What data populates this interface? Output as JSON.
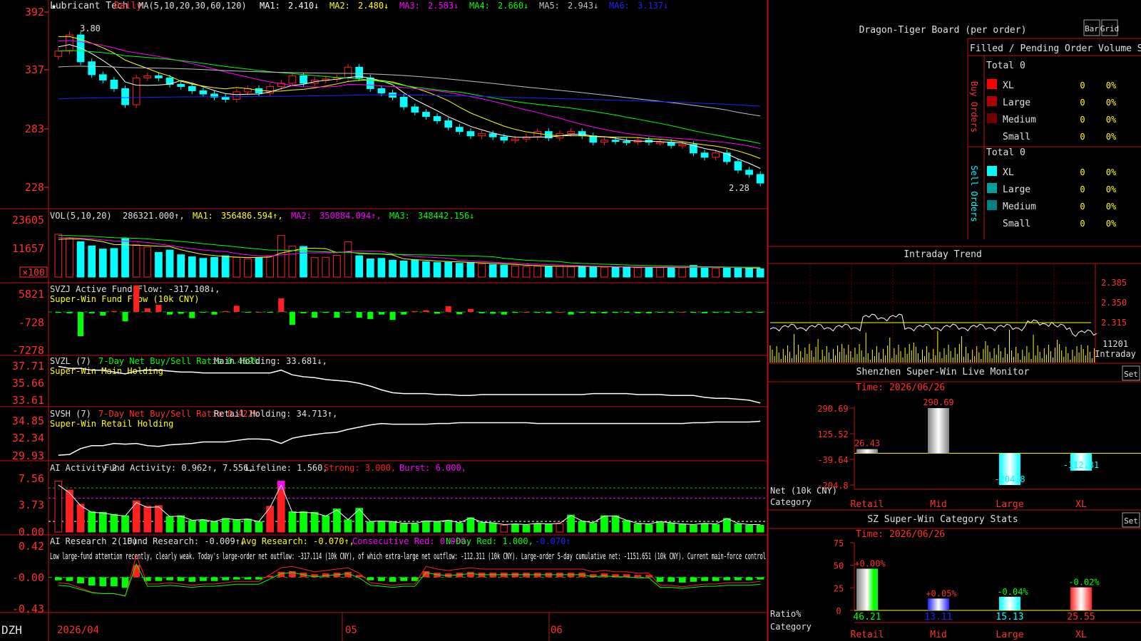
{
  "app": {
    "brand": "DZH",
    "stock_name": "Lubricant Tech",
    "period": "Daily",
    "date_ticks": [
      "2026/04",
      "05",
      "06"
    ]
  },
  "colors": {
    "up": "#ff2020",
    "down": "#00ffff",
    "grid": "#a00000",
    "ma1": "#ffffff",
    "ma2": "#ffff00",
    "ma3": "#ff00ff",
    "ma4": "#00ff00",
    "ma5": "#c0c0c0",
    "ma6": "#2020ff",
    "green_bar": "#00ff00"
  },
  "main": {
    "legend_prefix": "MA(5,10,20,30,60,120)",
    "ma": [
      {
        "label": "MA1:",
        "value": "2.410↓"
      },
      {
        "label": "MA2:",
        "value": "2.480↓"
      },
      {
        "label": "MA3:",
        "value": "2.583↓"
      },
      {
        "label": "MA4:",
        "value": "2.660↓"
      },
      {
        "label": "MA5:",
        "value": "2.943↓"
      },
      {
        "label": "MA6:",
        "value": "3.137↓"
      }
    ],
    "y_ticks": [
      "392",
      "337",
      "283",
      "228"
    ],
    "high_label": "3.80",
    "low_label": "2.28"
  },
  "vol": {
    "legend_prefix": "VOL(5,10,20)",
    "current": "286321.000↑,",
    "ma": [
      {
        "label": "MA1:",
        "value": "356486.594↑,"
      },
      {
        "label": "MA2:",
        "value": "350884.094↑,"
      },
      {
        "label": "MA3:",
        "value": "348442.156↓"
      }
    ],
    "y_ticks": [
      "23605",
      "11657"
    ],
    "unit": "×100"
  },
  "svzj": {
    "line1": "SVZJ Active Fund Flow: -317.108↓,",
    "line2": "Super-Win Fund Flow (10k CNY)",
    "y_ticks": [
      "5821",
      "-728",
      "-7278"
    ]
  },
  "svzl": {
    "name": "SVZL (7)",
    "desc": "7-Day Net Buy/Sell Ratio 0.469%",
    "holding": "Main Holding: 33.681↓,",
    "line2": "Super-Win Main Holding",
    "y_ticks": [
      "37.71",
      "35.66",
      "33.61"
    ]
  },
  "svsh": {
    "name": "SVSH (7)",
    "desc": "7-Day Net Buy/Sell Ratio 0.422%",
    "holding": "Retail Holding: 34.713↑,",
    "line2": "Super-Win Retail Holding",
    "y_ticks": [
      "34.85",
      "32.34",
      "29.93"
    ]
  },
  "ai_active": {
    "name": "AI Activity 2",
    "fund": "Fund Activity: 0.962↑, 7.556,",
    "life": "Lifeline: 1.560,",
    "strong": "Strong: 3.000,",
    "burst": "Burst: 6.000,",
    "y_ticks": [
      "7.56",
      "3.73",
      "0.00"
    ]
  },
  "ai_research": {
    "name": "AI Research 2(10)",
    "fund": "Fund Research: -0.009↑,",
    "avg": "Avg Research: -0.070↑,",
    "consec": "Consecutive Red: 0.000,",
    "nday": "N-Day Red: 1.000,",
    "last": "-0.070↑",
    "commentary": "Low large-fund attention recently, clearly weak. Today's large-order net outflow: -317.114 (10k CNY), of which extra-large net outflow: -112.311 (10k CNY). Large-order 5-day cumulative net: -1151.651 (10k CNY). Current main-force control",
    "y_ticks": [
      "0.42",
      "-0.00",
      "-0.43"
    ]
  },
  "right": {
    "dragon": {
      "title": "Dragon-Tiger Board (per order)",
      "btn1": "Bar",
      "btn2": "Grid",
      "stat_header": "Filled / Pending Order Volume Stats",
      "buy_label": "Buy Orders",
      "sell_label": "Sell Orders",
      "total_buy": "Total 0",
      "total_sell": "Total 0",
      "rows": [
        "XL",
        "Large",
        "Medium",
        "Small"
      ],
      "zero": "0",
      "pct": "0%"
    },
    "intraday": {
      "title": "Intraday Trend",
      "ticks": [
        "2.385",
        "2.350",
        "2.315"
      ],
      "vol_tick": "11201",
      "unit": "Intraday"
    },
    "monitor": {
      "title": "Shenzhen Super-Win Live Monitor",
      "time": "Time: 2026/06/26",
      "y_ticks": [
        "290.69",
        "125.52",
        "-39.64",
        "-204.8"
      ],
      "ylabel1": "Net (10k CNY)",
      "ylabel2": "Category",
      "settings": "Set"
    },
    "category": {
      "title": "SZ Super-Win Category Stats",
      "time": "Time: 2026/06/26",
      "y_ticks": [
        "75",
        "50",
        "25",
        "0"
      ],
      "ylabel1": "Ratio%",
      "ylabel2": "Category",
      "settings": "Set"
    }
  },
  "chart_data": [
    {
      "type": "bar",
      "title": "Shenzhen Super-Win Live Monitor",
      "categories": [
        "Retail",
        "Mid",
        "Large",
        "XL"
      ],
      "values": [
        26.43,
        290.69,
        -204.8,
        -112.31
      ],
      "value_labels": [
        "26.43",
        "290.69",
        "-204.8",
        "-112.31"
      ],
      "ylim": [
        -204.8,
        290.69
      ]
    },
    {
      "type": "bar",
      "title": "SZ Super-Win Category Stats",
      "categories": [
        "Retail",
        "Mid",
        "Large",
        "XL"
      ],
      "values": [
        46.21,
        13.11,
        15.13,
        25.55
      ],
      "change_labels": [
        "+0.00%",
        "+0.05%",
        "-0.04%",
        "-0.02%"
      ],
      "value_labels": [
        "46.21",
        "13.11",
        "15.13",
        "25.55"
      ],
      "ylim": [
        0,
        75
      ]
    },
    {
      "type": "line",
      "title": "Candlestick price",
      "ylim": [
        2.28,
        3.92
      ],
      "high": 3.8,
      "low": 2.28,
      "close": [
        3.55,
        3.7,
        3.45,
        3.33,
        3.28,
        3.2,
        3.05,
        3.3,
        3.32,
        3.3,
        3.24,
        3.22,
        3.18,
        3.15,
        3.12,
        3.1,
        3.17,
        3.2,
        3.16,
        3.22,
        3.25,
        3.32,
        3.25,
        3.28,
        3.29,
        3.3,
        3.4,
        3.3,
        3.2,
        3.16,
        3.12,
        3.03,
        2.98,
        2.94,
        2.9,
        2.84,
        2.8,
        2.76,
        2.78,
        2.75,
        2.72,
        2.73,
        2.75,
        2.8,
        2.74,
        2.78,
        2.8,
        2.76,
        2.7,
        2.72,
        2.71,
        2.7,
        2.72,
        2.7,
        2.7,
        2.67,
        2.68,
        2.6,
        2.56,
        2.6,
        2.52,
        2.44,
        2.4,
        2.32
      ],
      "ma": {
        "MA1": 2.41,
        "MA2": 2.48,
        "MA3": 2.583,
        "MA4": 2.66,
        "MA5": 2.943,
        "MA6": 3.137
      }
    },
    {
      "type": "bar",
      "title": "VOL",
      "values": [
        16500,
        15200,
        13600,
        12000,
        10800,
        11000,
        14800,
        12500,
        11600,
        9500,
        10400,
        8600,
        7800,
        7200,
        7600,
        8200,
        7600,
        7000,
        7500,
        8200,
        16000,
        11900,
        11800,
        7500,
        7600,
        8400,
        13600,
        8200,
        7000,
        7200,
        6500,
        6200,
        6600,
        5900,
        5600,
        5700,
        5300,
        5600,
        5100,
        4800,
        4600,
        4300,
        4100,
        4200,
        4000,
        4200,
        4000,
        4300,
        3800,
        3800,
        3700,
        4000,
        3600,
        3700,
        3600,
        3800,
        3600,
        4500,
        3500,
        3400,
        3500,
        3600,
        3400,
        3200
      ],
      "ma": {
        "MA1": 356486.594,
        "MA2": 350884.094,
        "MA3": 348442.156
      },
      "current": 286321.0
    },
    {
      "type": "bar",
      "title": "SVZJ",
      "values": [
        -200,
        -300,
        -5500,
        -300,
        -800,
        200,
        -2100,
        6000,
        800,
        1600,
        -600,
        -400,
        -1400,
        -100,
        -600,
        200,
        1400,
        -100,
        0,
        -100,
        3100,
        -2900,
        -300,
        -1300,
        -200,
        -1300,
        -200,
        -1300,
        -1600,
        -600,
        -1800,
        -600,
        200,
        400,
        -400,
        1300,
        -500,
        700,
        -300,
        -400,
        -600,
        -200,
        0,
        -200,
        -300,
        0,
        -600,
        -200,
        -300,
        -300,
        -200,
        -200,
        -300,
        -300,
        -100,
        -200,
        0,
        -200,
        -300,
        -200,
        -200,
        -100,
        -200,
        -100
      ]
    },
    {
      "type": "line",
      "title": "SVZL",
      "y": [
        37.6,
        37.4,
        37.4,
        37.2,
        37.2,
        37.0,
        36.8,
        37.1,
        37.2,
        37.2,
        37.1,
        37.0,
        37.0,
        36.9,
        36.9,
        36.9,
        36.9,
        36.9,
        36.9,
        36.9,
        37.2,
        36.7,
        36.5,
        36.4,
        36.2,
        36.1,
        36.0,
        35.8,
        35.5,
        35.1,
        34.8,
        34.7,
        34.7,
        34.7,
        34.6,
        34.6,
        34.5,
        34.5,
        34.6,
        34.6,
        34.6,
        34.6,
        34.6,
        34.6,
        34.6,
        34.6,
        34.6,
        34.6,
        34.7,
        34.7,
        34.7,
        34.7,
        34.6,
        34.6,
        34.6,
        34.5,
        34.5,
        34.5,
        34.3,
        34.2,
        34.2,
        34.1,
        34.0,
        33.7
      ]
    },
    {
      "type": "line",
      "title": "SVSH",
      "y": [
        30.3,
        30.4,
        31.2,
        31.6,
        31.6,
        31.9,
        31.8,
        31.9,
        31.6,
        31.5,
        31.7,
        31.8,
        31.9,
        32.1,
        32.1,
        32.1,
        32.3,
        32.5,
        32.5,
        32.4,
        31.9,
        32.6,
        32.9,
        33.1,
        33.3,
        33.4,
        33.8,
        34.1,
        34.4,
        34.6,
        34.5,
        34.5,
        34.5,
        34.5,
        34.6,
        34.6,
        34.7,
        34.7,
        34.7,
        34.7,
        34.7,
        34.7,
        34.7,
        34.6,
        34.6,
        34.6,
        34.6,
        34.6,
        34.6,
        34.6,
        34.6,
        34.6,
        34.6,
        34.6,
        34.6,
        34.6,
        34.6,
        34.7,
        34.7,
        34.8,
        34.8,
        34.8,
        34.8,
        34.9
      ]
    },
    {
      "type": "bar",
      "title": "AI Activity",
      "values": [
        7.5,
        6.2,
        4.1,
        3.0,
        2.9,
        2.6,
        2.4,
        4.6,
        3.8,
        3.9,
        2.3,
        2.4,
        1.7,
        1.8,
        1.5,
        2.0,
        1.8,
        1.9,
        1.5,
        3.8,
        7.5,
        3.0,
        3.0,
        2.9,
        2.4,
        3.4,
        1.8,
        3.5,
        1.5,
        1.6,
        1.5,
        1.2,
        1.2,
        1.6,
        1.5,
        1.7,
        1.3,
        2.1,
        1.4,
        1.3,
        1.0,
        1.1,
        1.0,
        1.2,
        1.1,
        1.2,
        2.5,
        1.6,
        1.3,
        2.4,
        2.4,
        1.7,
        1.2,
        1.1,
        1.5,
        1.3,
        1.1,
        1.0,
        1.2,
        1.1,
        2.0,
        1.2,
        1.0,
        1.0
      ],
      "thresholds": {
        "lifeline": 1.56,
        "strong": 3.0,
        "burst": 6.0
      }
    },
    {
      "type": "bar",
      "title": "AI Research",
      "values": [
        -0.04,
        -0.05,
        -0.08,
        -0.11,
        -0.12,
        -0.12,
        -0.14,
        0.16,
        -0.05,
        -0.05,
        -0.04,
        -0.05,
        -0.06,
        -0.05,
        -0.05,
        -0.04,
        -0.03,
        -0.03,
        -0.03,
        0.02,
        0.07,
        0.08,
        0.06,
        0.04,
        0.05,
        0.06,
        0.07,
        0.03,
        -0.04,
        -0.05,
        -0.06,
        -0.05,
        -0.05,
        0.08,
        0.06,
        0.05,
        0.06,
        0.07,
        0.06,
        0.06,
        0.06,
        0.06,
        0.06,
        0.06,
        0.06,
        0.06,
        0.06,
        0.06,
        0.04,
        0.05,
        0.04,
        0.04,
        0.03,
        0.03,
        -0.06,
        -0.06,
        -0.07,
        -0.06,
        -0.05,
        -0.05,
        -0.04,
        -0.04,
        -0.04,
        -0.03
      ],
      "ylim": [
        -0.43,
        0.42
      ]
    }
  ]
}
